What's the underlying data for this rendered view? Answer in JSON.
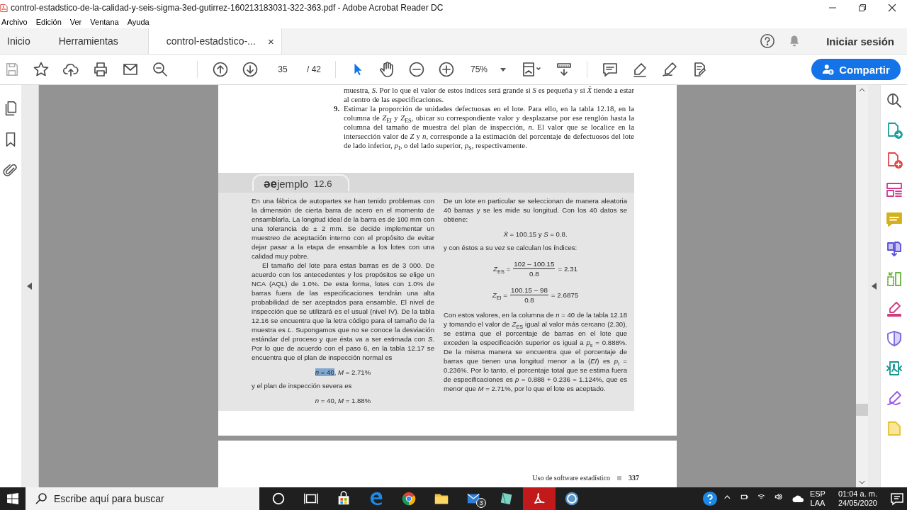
{
  "window": {
    "title": "control-estadstico-de-la-calidad-y-seis-sigma-3ed-gutirrez-160213183031-322-363.pdf - Adobe Acrobat Reader DC"
  },
  "menu": [
    "Archivo",
    "Edición",
    "Ver",
    "Ventana",
    "Ayuda"
  ],
  "tabs": [
    {
      "label": "Inicio",
      "selected": false
    },
    {
      "label": "Herramientas",
      "selected": false
    },
    {
      "label": "control-estadstico-...",
      "selected": true,
      "close": "×"
    }
  ],
  "sign_in": "Iniciar sesión",
  "toolbar": {
    "save_disabled": true,
    "page": "35",
    "page_count": "/ 42",
    "zoom": "75%",
    "share": "Compartir",
    "tools": [
      {
        "kind": "select",
        "selected": true
      },
      {
        "kind": "hand",
        "selected": false
      }
    ]
  },
  "page": {
    "top_paragraph": "muestra, *S*. Por lo que el valor de estos índices será grande si *S* es pequeña y si *X̄* tiende a estar al centro de las especificaciones.",
    "step": {
      "number": "9.",
      "text": "Estimar la proporción de unidades defectuosas en el lote. Para ello, en la tabla 12.18, en la columna de *Z*$_{EI}$ y *Z*$_{ES}$, ubicar su correspondiente valor y desplazarse por ese renglón hasta la columna del tamaño de muestra del plan de inspección, *n*. El valor que se localice en la intersección valor de *Z* y *n*, corresponde a la estimación del porcentaje de defectuosos del lote de lado inferior, *p*$_{I}$, o del lado superior, *p*$_{S}$, respectivamente."
    },
    "example": {
      "logo": "ǝe",
      "title": "jemplo",
      "number": "12.6",
      "left": [
        {
          "kind": "paragraph",
          "indented": false,
          "text": "En una fábrica de autopartes se han tenido problemas con la dimensión de cierta barra de acero en el momento de ensamblarla. La longitud ideal de la barra es de 100 mm con una tolerancia de ± 2 mm. Se decide implementar un muestreo de aceptación interno con el propósito de evitar dejar pasar a la etapa de ensamble a los lotes con una calidad muy pobre."
        },
        {
          "kind": "paragraph",
          "indented": true,
          "text": "El tamaño del lote para estas barras es de 3 000. De acuerdo con los antecedentes y los propósitos se elige un NCA (AQL) de 1.0%. De esta forma, lotes con 1.0% de barras fuera de las especificaciones tendrán una alta probabilidad de ser aceptados para ensamble. El nivel de inspección que se utilizará es el usual (nivel IV). De la tabla 12.16 se encuentra que la letra código para el tamaño de la muestra es *L*. Supongamos que no se conoce la desviación estándar del proceso y que ésta va a ser estimada con *S*. Por lo que de acuerdo con el paso 6, en la tabla 12.17 se encuentra que el plan de inspección normal es"
        },
        {
          "kind": "formula",
          "selection": "*n* = 40",
          "text": ", *M* = 2.71%"
        },
        {
          "kind": "paragraph",
          "indented": false,
          "text": "y el plan de inspección severa es"
        },
        {
          "kind": "formula",
          "text": "*n* = 40, *M* = 1.88%"
        }
      ],
      "right": [
        {
          "kind": "paragraph",
          "indented": false,
          "text": "De un lote en particular se seleccionan de manera aleatoria 40 barras y se les mide su longitud. Con los 40 datos se obtiene:"
        },
        {
          "kind": "formula",
          "text": "*X̄* = 100.15 y *S* = 0.8."
        },
        {
          "kind": "paragraph",
          "indented": false,
          "text": "y con éstos a su vez se calculan los índices:"
        },
        {
          "kind": "fraction",
          "lhs": "*Z*$_{ES}$ =",
          "numerator": "102 – 100.15",
          "denominator": "0.8",
          "result": "= 2.31"
        },
        {
          "kind": "fraction",
          "lhs": "*Z*$_{EI}$ =",
          "numerator": "100.15 – 98",
          "denominator": "0.8",
          "result": "= 2.6875"
        },
        {
          "kind": "paragraph",
          "indented": false,
          "text": "Con estos valores, en la columna de *n* = 40 de la tabla 12.18 y tomando el valor de *Z*$_{ES}$ igual al valor más cercano (2.30), se estima que el porcentaje de barras en el lote que exceden la especificación superior es igual a *p*$_{s}$ = 0.888%. De la misma manera se encuentra que el porcentaje de barras que tienen una longitud menor a la (*EI*) es *p*$_{i}$ = 0.236%. Por lo tanto, el porcentaje total que se estima fuera de especificaciones es *p* = 0.888 + 0.236 = 1.124%, que es menor que *M* = 2.71%, por lo que el lote es aceptado."
        }
      ]
    }
  },
  "next_page": {
    "footer": "Uso de software estadístico",
    "page_number": "337"
  },
  "taskbar": {
    "search_placeholder": "Escribe aquí para buscar",
    "apps": [
      {
        "kind": "cortana",
        "selected": false
      },
      {
        "kind": "task_view",
        "selected": false
      },
      {
        "kind": "store",
        "selected": false
      },
      {
        "kind": "edge",
        "selected": false
      },
      {
        "kind": "chrome",
        "selected": false
      },
      {
        "kind": "explorer",
        "selected": false
      },
      {
        "kind": "mail",
        "selected": false,
        "badge": "3"
      },
      {
        "kind": "notes",
        "selected": false
      },
      {
        "kind": "acrobat",
        "selected": true
      },
      {
        "kind": "recorder",
        "selected": false
      }
    ],
    "language": "ESP",
    "layout": "LAA",
    "time": "01:04 a. m.",
    "date": "24/05/2020"
  }
}
